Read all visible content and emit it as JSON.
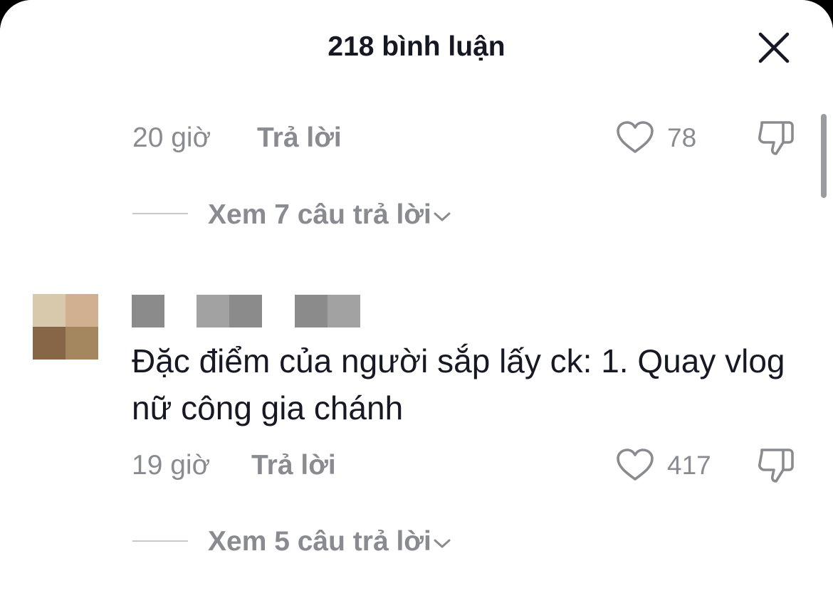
{
  "header": {
    "title": "218 bình luận"
  },
  "comments": [
    {
      "partial_text": "",
      "time": "20 giờ",
      "reply_label": "Trả lời",
      "likes": "78",
      "view_replies": "Xem 7 câu trả lời"
    },
    {
      "username": "",
      "text": "Đặc điểm của người sắp lấy ck: 1. Quay vlog nữ công gia chánh",
      "time": "19 giờ",
      "reply_label": "Trả lời",
      "likes": "417",
      "view_replies": "Xem 5 câu trả lời"
    }
  ],
  "icons": {
    "close": "close-icon",
    "like": "heart-outline-icon",
    "dislike": "thumbs-down-icon",
    "chevron": "chevron-down-icon"
  },
  "colors": {
    "text_primary": "#161823",
    "text_secondary": "#8a8b91",
    "avatar_pixels": [
      "#d8c8ac",
      "#d1b092",
      "#876547",
      "#a4875f"
    ],
    "username_blur": [
      "#8b8b8b",
      "#a2a2a2"
    ]
  }
}
